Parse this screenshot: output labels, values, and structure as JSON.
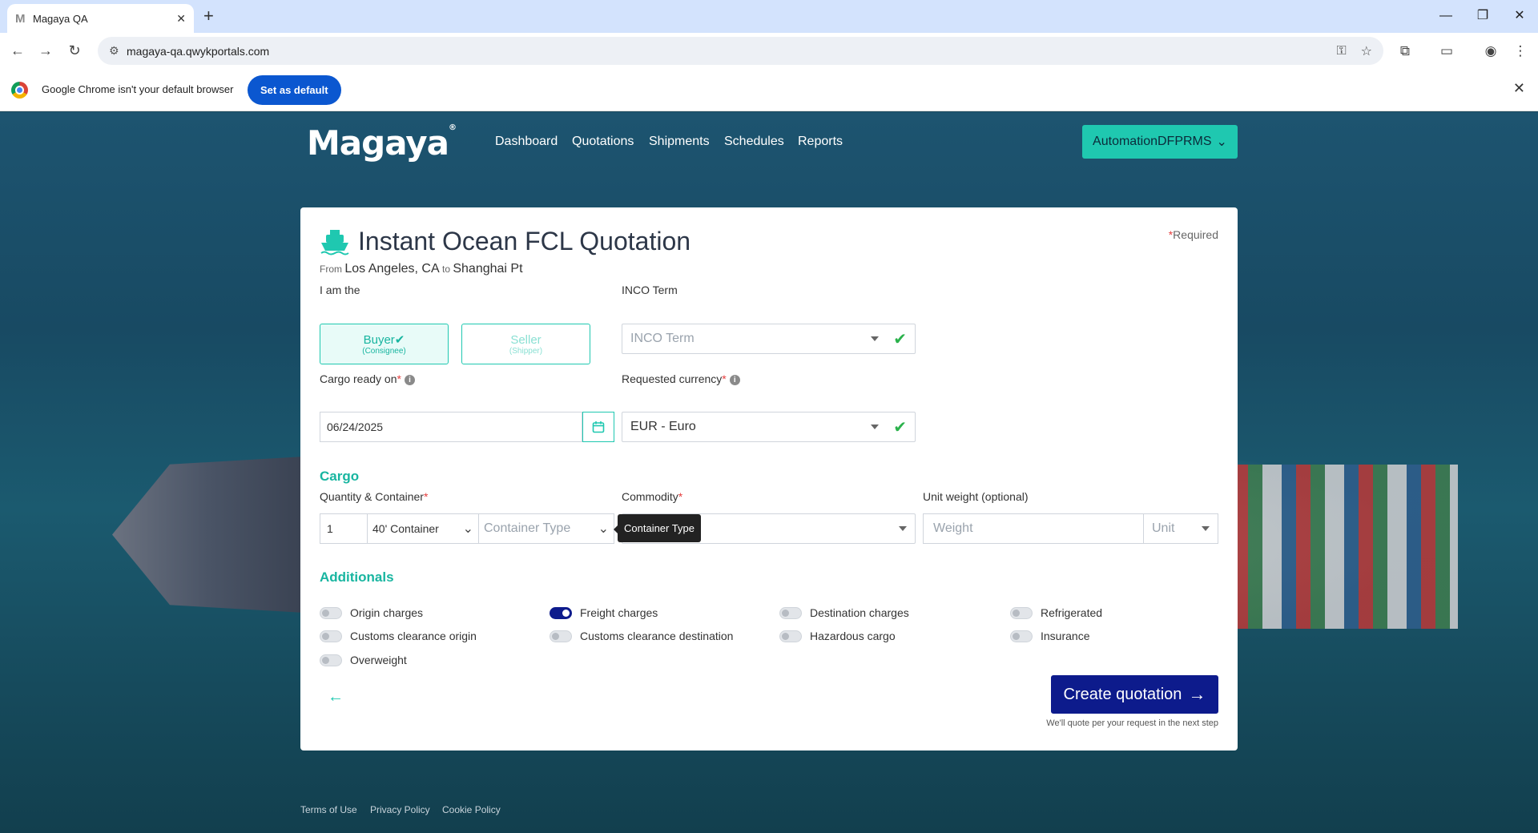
{
  "browser": {
    "tab_title": "Magaya QA",
    "favicon": "M",
    "new_tab": "+",
    "url": "magaya-qa.qwykportals.com",
    "infobar_text": "Google Chrome isn't your default browser",
    "set_default_label": "Set as default"
  },
  "nav": {
    "logo": "Magaya",
    "links": [
      "Dashboard",
      "Quotations",
      "Shipments",
      "Schedules",
      "Reports"
    ],
    "account": "AutomationDFPRMS"
  },
  "card": {
    "title": "Instant Ocean FCL Quotation",
    "from_label": "From",
    "from": "Los Angeles, CA",
    "to_label": "to",
    "to": "Shanghai Pt",
    "required_note": "Required",
    "iam_label": "I am the",
    "buyer": "Buyer",
    "buyer_sub": "(Consignee)",
    "seller": "Seller",
    "seller_sub": "(Shipper)",
    "inco_label": "INCO Term",
    "inco_placeholder": "INCO Term",
    "cargo_ready_label": "Cargo ready on",
    "cargo_ready_value": "06/24/2025",
    "currency_label": "Requested currency",
    "currency_value": "EUR - Euro",
    "cargo_section": "Cargo",
    "qty_label": "Quantity & Container",
    "qty_value": "1",
    "container_value": "40' Container",
    "container_type_placeholder": "Container Type",
    "tooltip": "Container Type",
    "commodity_label": "Commodity",
    "unit_weight_label": "Unit weight (optional)",
    "weight_placeholder": "Weight",
    "unit_placeholder": "Unit",
    "additionals_section": "Additionals",
    "additionals": [
      {
        "label": "Origin charges",
        "on": false
      },
      {
        "label": "Freight charges",
        "on": true
      },
      {
        "label": "Destination charges",
        "on": false
      },
      {
        "label": "Refrigerated",
        "on": false
      },
      {
        "label": "Customs clearance origin",
        "on": false
      },
      {
        "label": "Customs clearance destination",
        "on": false
      },
      {
        "label": "Hazardous cargo",
        "on": false
      },
      {
        "label": "Insurance",
        "on": false
      },
      {
        "label": "Overweight",
        "on": false
      }
    ],
    "create_label": "Create quotation",
    "create_note": "We'll quote per your request in the next step"
  },
  "footer": [
    "Terms of Use",
    "Privacy Policy",
    "Cookie Policy"
  ],
  "colors": {
    "accent": "#1fc8b0",
    "primary": "#0d1b8c",
    "required": "#e53e3e"
  }
}
